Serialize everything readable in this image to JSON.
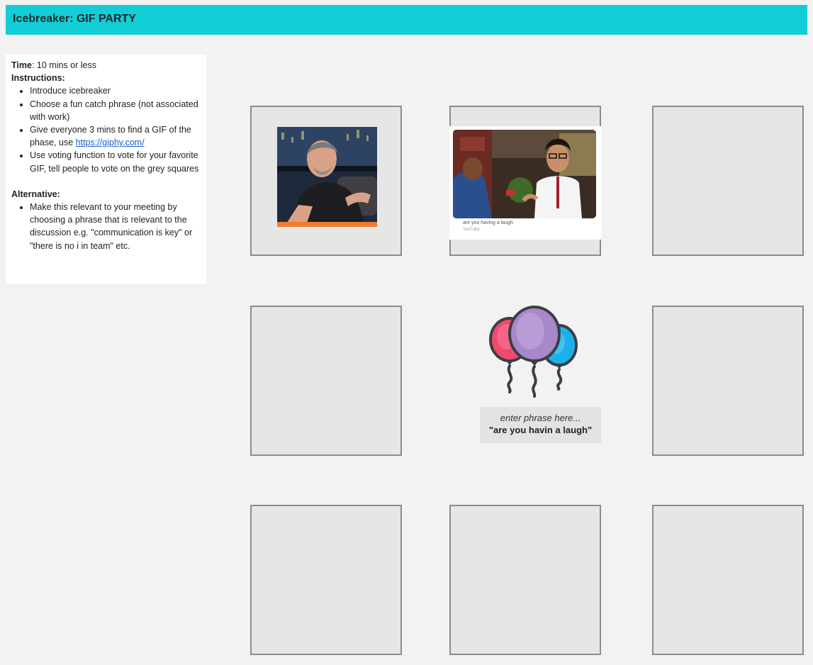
{
  "header": {
    "title": "Icebreaker: GIF PARTY"
  },
  "instructions": {
    "time_label": "Time",
    "time_value": ": 10 mins or less",
    "instructions_label": "Instructions:",
    "steps": [
      "Introduce icebreaker",
      "Choose a fun catch phrase (not associated with work)",
      "Give everyone 3 mins to find a GIF of the phase, use ",
      "Use voting function to vote for your favorite GIF, tell people to vote on the grey squares"
    ],
    "link_text": "https://giphy.com/",
    "alternative_label": "Alternative:",
    "alternative_items": [
      "Make this relevant to your meeting by choosing a phrase that is relevant to the discussion e.g. \"communication is key\" or \"there is no i in team\" etc."
    ]
  },
  "gif_card": {
    "caption": "are you having a laugh",
    "source": "YouTube"
  },
  "center": {
    "icon": "balloons-icon",
    "hint": "enter phrase here...",
    "phrase": "\"are you havin a laugh\""
  },
  "colors": {
    "header_bg": "#13cdd6",
    "square_bg": "#e6e6e6",
    "square_border": "#8c8c8c",
    "balloon_pink": "#ef4a6e",
    "balloon_purple": "#a788c9",
    "balloon_blue": "#1ab0ea"
  }
}
